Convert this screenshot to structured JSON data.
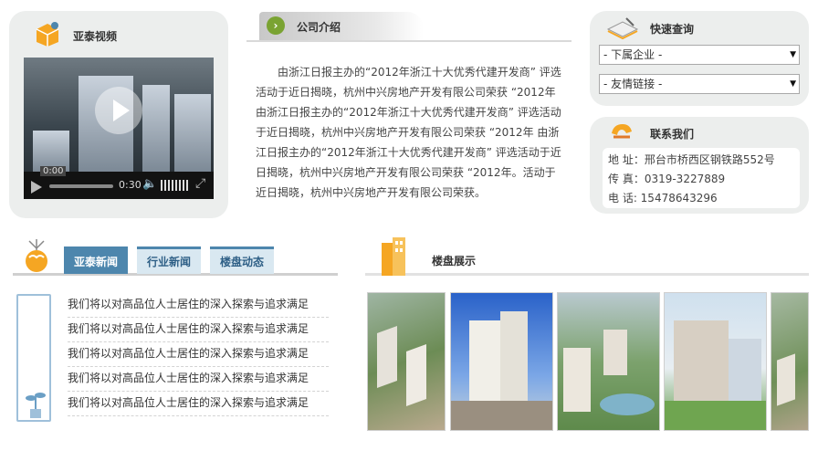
{
  "video_panel": {
    "title": "亚泰视频",
    "time_current": "0:00",
    "time_total": "0:30"
  },
  "intro": {
    "title": "公司介绍",
    "text": "由浙江日报主办的“2012年浙江十大优秀代建开发商” 评选活动于近日揭晓，杭州中兴房地产开发有限公司荣获 “2012年 由浙江日报主办的“2012年浙江十大优秀代建开发商” 评选活动于近日揭晓，杭州中兴房地产开发有限公司荣获 “2012年 由浙江日报主办的“2012年浙江十大优秀代建开发商” 评选活动于近日揭晓，杭州中兴房地产开发有限公司荣获 “2012年。活动于近日揭晓，杭州中兴房地产开发有限公司荣获。"
  },
  "search": {
    "title": "快速查询",
    "select1": "- 下属企业 -",
    "select2": "- 友情链接 -"
  },
  "contact": {
    "title": "联系我们",
    "address": "地 址：邢台市桥西区钢铁路552号",
    "fax": "传 真：0319-3227889",
    "phone": "电 话: 15478643296"
  },
  "news": {
    "tabs": [
      "亚泰新闻",
      "行业新闻",
      "楼盘动态"
    ],
    "items": [
      "我们将以对高品位人士居住的深入探索与追求满足",
      "我们将以对高品位人士居住的深入探索与追求满足",
      "我们将以对高品位人士居住的深入探索与追求满足",
      "我们将以对高品位人士居住的深入探索与追求满足",
      "我们将以对高品位人士居住的深入探索与追求满足"
    ]
  },
  "projects": {
    "title": "楼盘展示"
  },
  "colors": {
    "accent_blue": "#4d86ad",
    "panel_bg": "#eceeed",
    "icon_orange": "#f5a623"
  }
}
